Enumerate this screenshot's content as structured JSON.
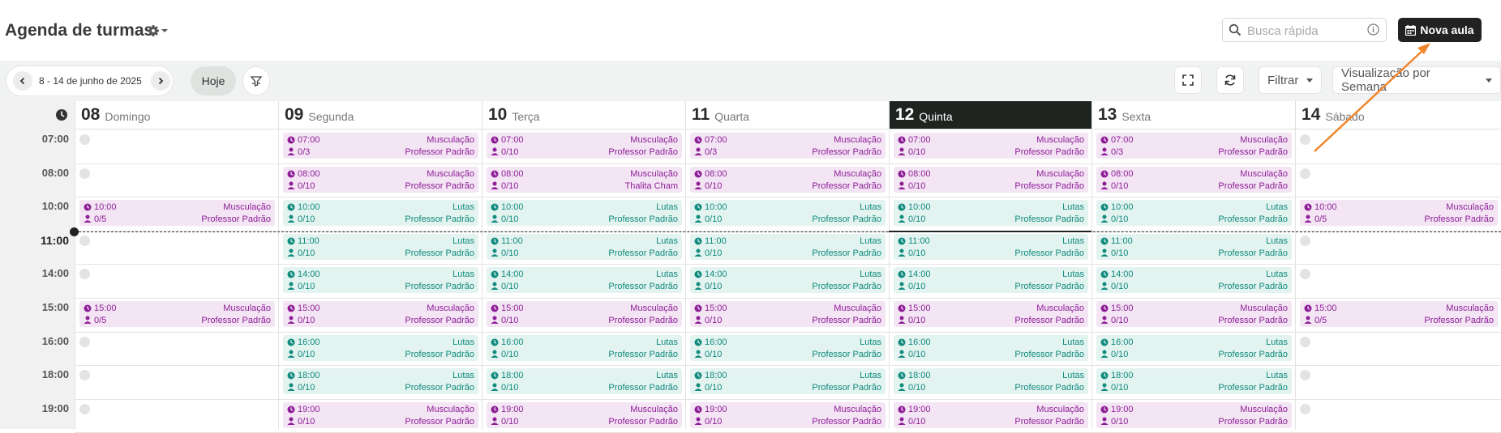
{
  "header": {
    "title": "Agenda de turmas",
    "search_placeholder": "Busca rápida",
    "new_class_label": "Nova aula"
  },
  "toolbar": {
    "date_range": "8 - 14 de junho de 2025",
    "today_label": "Hoje",
    "filter_label": "Filtrar",
    "view_label": "Visualização por Semana"
  },
  "colors": {
    "musculacao_bg": "#f3e5f4",
    "musculacao_text": "#8e1e97",
    "lutas_bg": "#e3f3f0",
    "lutas_text": "#108b7d",
    "today_header": "#1f2420",
    "annotation_arrow": "#f0862c"
  },
  "days": [
    {
      "num": "08",
      "name": "Domingo",
      "today": false
    },
    {
      "num": "09",
      "name": "Segunda",
      "today": false
    },
    {
      "num": "10",
      "name": "Terça",
      "today": false
    },
    {
      "num": "11",
      "name": "Quarta",
      "today": false
    },
    {
      "num": "12",
      "name": "Quinta",
      "today": true
    },
    {
      "num": "13",
      "name": "Sexta",
      "today": false
    },
    {
      "num": "14",
      "name": "Sábado",
      "today": false
    }
  ],
  "time_slots": [
    "07:00",
    "08:00",
    "10:00",
    "11:00",
    "14:00",
    "15:00",
    "16:00",
    "18:00",
    "19:00"
  ],
  "current_time_slot": "11:00",
  "events": [
    {
      "day": 1,
      "slot": 0,
      "time": "07:00",
      "type": "m",
      "name": "Musculação",
      "capacity": "0/3",
      "teacher": "Professor Padrão"
    },
    {
      "day": 2,
      "slot": 0,
      "time": "07:00",
      "type": "m",
      "name": "Musculação",
      "capacity": "0/10",
      "teacher": "Professor Padrão"
    },
    {
      "day": 3,
      "slot": 0,
      "time": "07:00",
      "type": "m",
      "name": "Musculação",
      "capacity": "0/3",
      "teacher": "Professor Padrão"
    },
    {
      "day": 4,
      "slot": 0,
      "time": "07:00",
      "type": "m",
      "name": "Musculação",
      "capacity": "0/10",
      "teacher": "Professor Padrão"
    },
    {
      "day": 5,
      "slot": 0,
      "time": "07:00",
      "type": "m",
      "name": "Musculação",
      "capacity": "0/3",
      "teacher": "Professor Padrão"
    },
    {
      "day": 1,
      "slot": 1,
      "time": "08:00",
      "type": "m",
      "name": "Musculação",
      "capacity": "0/10",
      "teacher": "Professor Padrão"
    },
    {
      "day": 2,
      "slot": 1,
      "time": "08:00",
      "type": "m",
      "name": "Musculação",
      "capacity": "0/10",
      "teacher": "Thalita Cham"
    },
    {
      "day": 3,
      "slot": 1,
      "time": "08:00",
      "type": "m",
      "name": "Musculação",
      "capacity": "0/10",
      "teacher": "Professor Padrão"
    },
    {
      "day": 4,
      "slot": 1,
      "time": "08:00",
      "type": "m",
      "name": "Musculação",
      "capacity": "0/10",
      "teacher": "Professor Padrão"
    },
    {
      "day": 5,
      "slot": 1,
      "time": "08:00",
      "type": "m",
      "name": "Musculação",
      "capacity": "0/10",
      "teacher": "Professor Padrão"
    },
    {
      "day": 0,
      "slot": 2,
      "time": "10:00",
      "type": "m",
      "name": "Musculação",
      "capacity": "0/5",
      "teacher": "Professor Padrão"
    },
    {
      "day": 1,
      "slot": 2,
      "time": "10:00",
      "type": "l",
      "name": "Lutas",
      "capacity": "0/10",
      "teacher": "Professor Padrão"
    },
    {
      "day": 2,
      "slot": 2,
      "time": "10:00",
      "type": "l",
      "name": "Lutas",
      "capacity": "0/10",
      "teacher": "Professor Padrão"
    },
    {
      "day": 3,
      "slot": 2,
      "time": "10:00",
      "type": "l",
      "name": "Lutas",
      "capacity": "0/10",
      "teacher": "Professor Padrão"
    },
    {
      "day": 4,
      "slot": 2,
      "time": "10:00",
      "type": "l",
      "name": "Lutas",
      "capacity": "0/10",
      "teacher": "Professor Padrão"
    },
    {
      "day": 5,
      "slot": 2,
      "time": "10:00",
      "type": "l",
      "name": "Lutas",
      "capacity": "0/10",
      "teacher": "Professor Padrão"
    },
    {
      "day": 6,
      "slot": 2,
      "time": "10:00",
      "type": "m",
      "name": "Musculação",
      "capacity": "0/5",
      "teacher": "Professor Padrão"
    },
    {
      "day": 1,
      "slot": 3,
      "time": "11:00",
      "type": "l",
      "name": "Lutas",
      "capacity": "0/10",
      "teacher": "Professor Padrão"
    },
    {
      "day": 2,
      "slot": 3,
      "time": "11:00",
      "type": "l",
      "name": "Lutas",
      "capacity": "0/10",
      "teacher": "Professor Padrão"
    },
    {
      "day": 3,
      "slot": 3,
      "time": "11:00",
      "type": "l",
      "name": "Lutas",
      "capacity": "0/10",
      "teacher": "Professor Padrão"
    },
    {
      "day": 4,
      "slot": 3,
      "time": "11:00",
      "type": "l",
      "name": "Lutas",
      "capacity": "0/10",
      "teacher": "Professor Padrão"
    },
    {
      "day": 5,
      "slot": 3,
      "time": "11:00",
      "type": "l",
      "name": "Lutas",
      "capacity": "0/10",
      "teacher": "Professor Padrão"
    },
    {
      "day": 1,
      "slot": 4,
      "time": "14:00",
      "type": "l",
      "name": "Lutas",
      "capacity": "0/10",
      "teacher": "Professor Padrão"
    },
    {
      "day": 2,
      "slot": 4,
      "time": "14:00",
      "type": "l",
      "name": "Lutas",
      "capacity": "0/10",
      "teacher": "Professor Padrão"
    },
    {
      "day": 3,
      "slot": 4,
      "time": "14:00",
      "type": "l",
      "name": "Lutas",
      "capacity": "0/10",
      "teacher": "Professor Padrão"
    },
    {
      "day": 4,
      "slot": 4,
      "time": "14:00",
      "type": "l",
      "name": "Lutas",
      "capacity": "0/10",
      "teacher": "Professor Padrão"
    },
    {
      "day": 5,
      "slot": 4,
      "time": "14:00",
      "type": "l",
      "name": "Lutas",
      "capacity": "0/10",
      "teacher": "Professor Padrão"
    },
    {
      "day": 0,
      "slot": 5,
      "time": "15:00",
      "type": "m",
      "name": "Musculação",
      "capacity": "0/5",
      "teacher": "Professor Padrão"
    },
    {
      "day": 1,
      "slot": 5,
      "time": "15:00",
      "type": "m",
      "name": "Musculação",
      "capacity": "0/10",
      "teacher": "Professor Padrão"
    },
    {
      "day": 2,
      "slot": 5,
      "time": "15:00",
      "type": "m",
      "name": "Musculação",
      "capacity": "0/10",
      "teacher": "Professor Padrão"
    },
    {
      "day": 3,
      "slot": 5,
      "time": "15:00",
      "type": "m",
      "name": "Musculação",
      "capacity": "0/10",
      "teacher": "Professor Padrão"
    },
    {
      "day": 4,
      "slot": 5,
      "time": "15:00",
      "type": "m",
      "name": "Musculação",
      "capacity": "0/10",
      "teacher": "Professor Padrão"
    },
    {
      "day": 5,
      "slot": 5,
      "time": "15:00",
      "type": "m",
      "name": "Musculação",
      "capacity": "0/10",
      "teacher": "Professor Padrão"
    },
    {
      "day": 6,
      "slot": 5,
      "time": "15:00",
      "type": "m",
      "name": "Musculação",
      "capacity": "0/5",
      "teacher": "Professor Padrão"
    },
    {
      "day": 1,
      "slot": 6,
      "time": "16:00",
      "type": "l",
      "name": "Lutas",
      "capacity": "0/10",
      "teacher": "Professor Padrão"
    },
    {
      "day": 2,
      "slot": 6,
      "time": "16:00",
      "type": "l",
      "name": "Lutas",
      "capacity": "0/10",
      "teacher": "Professor Padrão"
    },
    {
      "day": 3,
      "slot": 6,
      "time": "16:00",
      "type": "l",
      "name": "Lutas",
      "capacity": "0/10",
      "teacher": "Professor Padrão"
    },
    {
      "day": 4,
      "slot": 6,
      "time": "16:00",
      "type": "l",
      "name": "Lutas",
      "capacity": "0/10",
      "teacher": "Professor Padrão"
    },
    {
      "day": 5,
      "slot": 6,
      "time": "16:00",
      "type": "l",
      "name": "Lutas",
      "capacity": "0/10",
      "teacher": "Professor Padrão"
    },
    {
      "day": 1,
      "slot": 7,
      "time": "18:00",
      "type": "l",
      "name": "Lutas",
      "capacity": "0/10",
      "teacher": "Professor Padrão"
    },
    {
      "day": 2,
      "slot": 7,
      "time": "18:00",
      "type": "l",
      "name": "Lutas",
      "capacity": "0/10",
      "teacher": "Professor Padrão"
    },
    {
      "day": 3,
      "slot": 7,
      "time": "18:00",
      "type": "l",
      "name": "Lutas",
      "capacity": "0/10",
      "teacher": "Professor Padrão"
    },
    {
      "day": 4,
      "slot": 7,
      "time": "18:00",
      "type": "l",
      "name": "Lutas",
      "capacity": "0/10",
      "teacher": "Professor Padrão"
    },
    {
      "day": 5,
      "slot": 7,
      "time": "18:00",
      "type": "l",
      "name": "Lutas",
      "capacity": "0/10",
      "teacher": "Professor Padrão"
    },
    {
      "day": 1,
      "slot": 8,
      "time": "19:00",
      "type": "m",
      "name": "Musculação",
      "capacity": "0/10",
      "teacher": "Professor Padrão"
    },
    {
      "day": 2,
      "slot": 8,
      "time": "19:00",
      "type": "m",
      "name": "Musculação",
      "capacity": "0/10",
      "teacher": "Professor Padrão"
    },
    {
      "day": 3,
      "slot": 8,
      "time": "19:00",
      "type": "m",
      "name": "Musculação",
      "capacity": "0/10",
      "teacher": "Professor Padrão"
    },
    {
      "day": 4,
      "slot": 8,
      "time": "19:00",
      "type": "m",
      "name": "Musculação",
      "capacity": "0/10",
      "teacher": "Professor Padrão"
    },
    {
      "day": 5,
      "slot": 8,
      "time": "19:00",
      "type": "m",
      "name": "Musculação",
      "capacity": "0/10",
      "teacher": "Professor Padrão"
    }
  ]
}
